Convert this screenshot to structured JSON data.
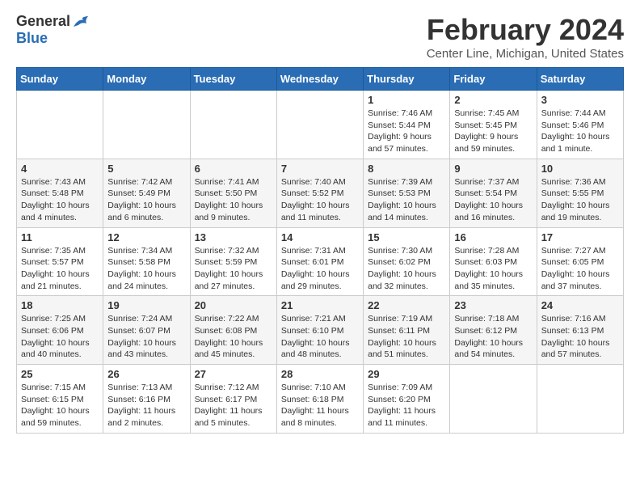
{
  "logo": {
    "general": "General",
    "blue": "Blue"
  },
  "title": "February 2024",
  "location": "Center Line, Michigan, United States",
  "days_of_week": [
    "Sunday",
    "Monday",
    "Tuesday",
    "Wednesday",
    "Thursday",
    "Friday",
    "Saturday"
  ],
  "weeks": [
    [
      {
        "day": "",
        "info": ""
      },
      {
        "day": "",
        "info": ""
      },
      {
        "day": "",
        "info": ""
      },
      {
        "day": "",
        "info": ""
      },
      {
        "day": "1",
        "info": "Sunrise: 7:46 AM\nSunset: 5:44 PM\nDaylight: 9 hours and 57 minutes."
      },
      {
        "day": "2",
        "info": "Sunrise: 7:45 AM\nSunset: 5:45 PM\nDaylight: 9 hours and 59 minutes."
      },
      {
        "day": "3",
        "info": "Sunrise: 7:44 AM\nSunset: 5:46 PM\nDaylight: 10 hours and 1 minute."
      }
    ],
    [
      {
        "day": "4",
        "info": "Sunrise: 7:43 AM\nSunset: 5:48 PM\nDaylight: 10 hours and 4 minutes."
      },
      {
        "day": "5",
        "info": "Sunrise: 7:42 AM\nSunset: 5:49 PM\nDaylight: 10 hours and 6 minutes."
      },
      {
        "day": "6",
        "info": "Sunrise: 7:41 AM\nSunset: 5:50 PM\nDaylight: 10 hours and 9 minutes."
      },
      {
        "day": "7",
        "info": "Sunrise: 7:40 AM\nSunset: 5:52 PM\nDaylight: 10 hours and 11 minutes."
      },
      {
        "day": "8",
        "info": "Sunrise: 7:39 AM\nSunset: 5:53 PM\nDaylight: 10 hours and 14 minutes."
      },
      {
        "day": "9",
        "info": "Sunrise: 7:37 AM\nSunset: 5:54 PM\nDaylight: 10 hours and 16 minutes."
      },
      {
        "day": "10",
        "info": "Sunrise: 7:36 AM\nSunset: 5:55 PM\nDaylight: 10 hours and 19 minutes."
      }
    ],
    [
      {
        "day": "11",
        "info": "Sunrise: 7:35 AM\nSunset: 5:57 PM\nDaylight: 10 hours and 21 minutes."
      },
      {
        "day": "12",
        "info": "Sunrise: 7:34 AM\nSunset: 5:58 PM\nDaylight: 10 hours and 24 minutes."
      },
      {
        "day": "13",
        "info": "Sunrise: 7:32 AM\nSunset: 5:59 PM\nDaylight: 10 hours and 27 minutes."
      },
      {
        "day": "14",
        "info": "Sunrise: 7:31 AM\nSunset: 6:01 PM\nDaylight: 10 hours and 29 minutes."
      },
      {
        "day": "15",
        "info": "Sunrise: 7:30 AM\nSunset: 6:02 PM\nDaylight: 10 hours and 32 minutes."
      },
      {
        "day": "16",
        "info": "Sunrise: 7:28 AM\nSunset: 6:03 PM\nDaylight: 10 hours and 35 minutes."
      },
      {
        "day": "17",
        "info": "Sunrise: 7:27 AM\nSunset: 6:05 PM\nDaylight: 10 hours and 37 minutes."
      }
    ],
    [
      {
        "day": "18",
        "info": "Sunrise: 7:25 AM\nSunset: 6:06 PM\nDaylight: 10 hours and 40 minutes."
      },
      {
        "day": "19",
        "info": "Sunrise: 7:24 AM\nSunset: 6:07 PM\nDaylight: 10 hours and 43 minutes."
      },
      {
        "day": "20",
        "info": "Sunrise: 7:22 AM\nSunset: 6:08 PM\nDaylight: 10 hours and 45 minutes."
      },
      {
        "day": "21",
        "info": "Sunrise: 7:21 AM\nSunset: 6:10 PM\nDaylight: 10 hours and 48 minutes."
      },
      {
        "day": "22",
        "info": "Sunrise: 7:19 AM\nSunset: 6:11 PM\nDaylight: 10 hours and 51 minutes."
      },
      {
        "day": "23",
        "info": "Sunrise: 7:18 AM\nSunset: 6:12 PM\nDaylight: 10 hours and 54 minutes."
      },
      {
        "day": "24",
        "info": "Sunrise: 7:16 AM\nSunset: 6:13 PM\nDaylight: 10 hours and 57 minutes."
      }
    ],
    [
      {
        "day": "25",
        "info": "Sunrise: 7:15 AM\nSunset: 6:15 PM\nDaylight: 10 hours and 59 minutes."
      },
      {
        "day": "26",
        "info": "Sunrise: 7:13 AM\nSunset: 6:16 PM\nDaylight: 11 hours and 2 minutes."
      },
      {
        "day": "27",
        "info": "Sunrise: 7:12 AM\nSunset: 6:17 PM\nDaylight: 11 hours and 5 minutes."
      },
      {
        "day": "28",
        "info": "Sunrise: 7:10 AM\nSunset: 6:18 PM\nDaylight: 11 hours and 8 minutes."
      },
      {
        "day": "29",
        "info": "Sunrise: 7:09 AM\nSunset: 6:20 PM\nDaylight: 11 hours and 11 minutes."
      },
      {
        "day": "",
        "info": ""
      },
      {
        "day": "",
        "info": ""
      }
    ]
  ]
}
